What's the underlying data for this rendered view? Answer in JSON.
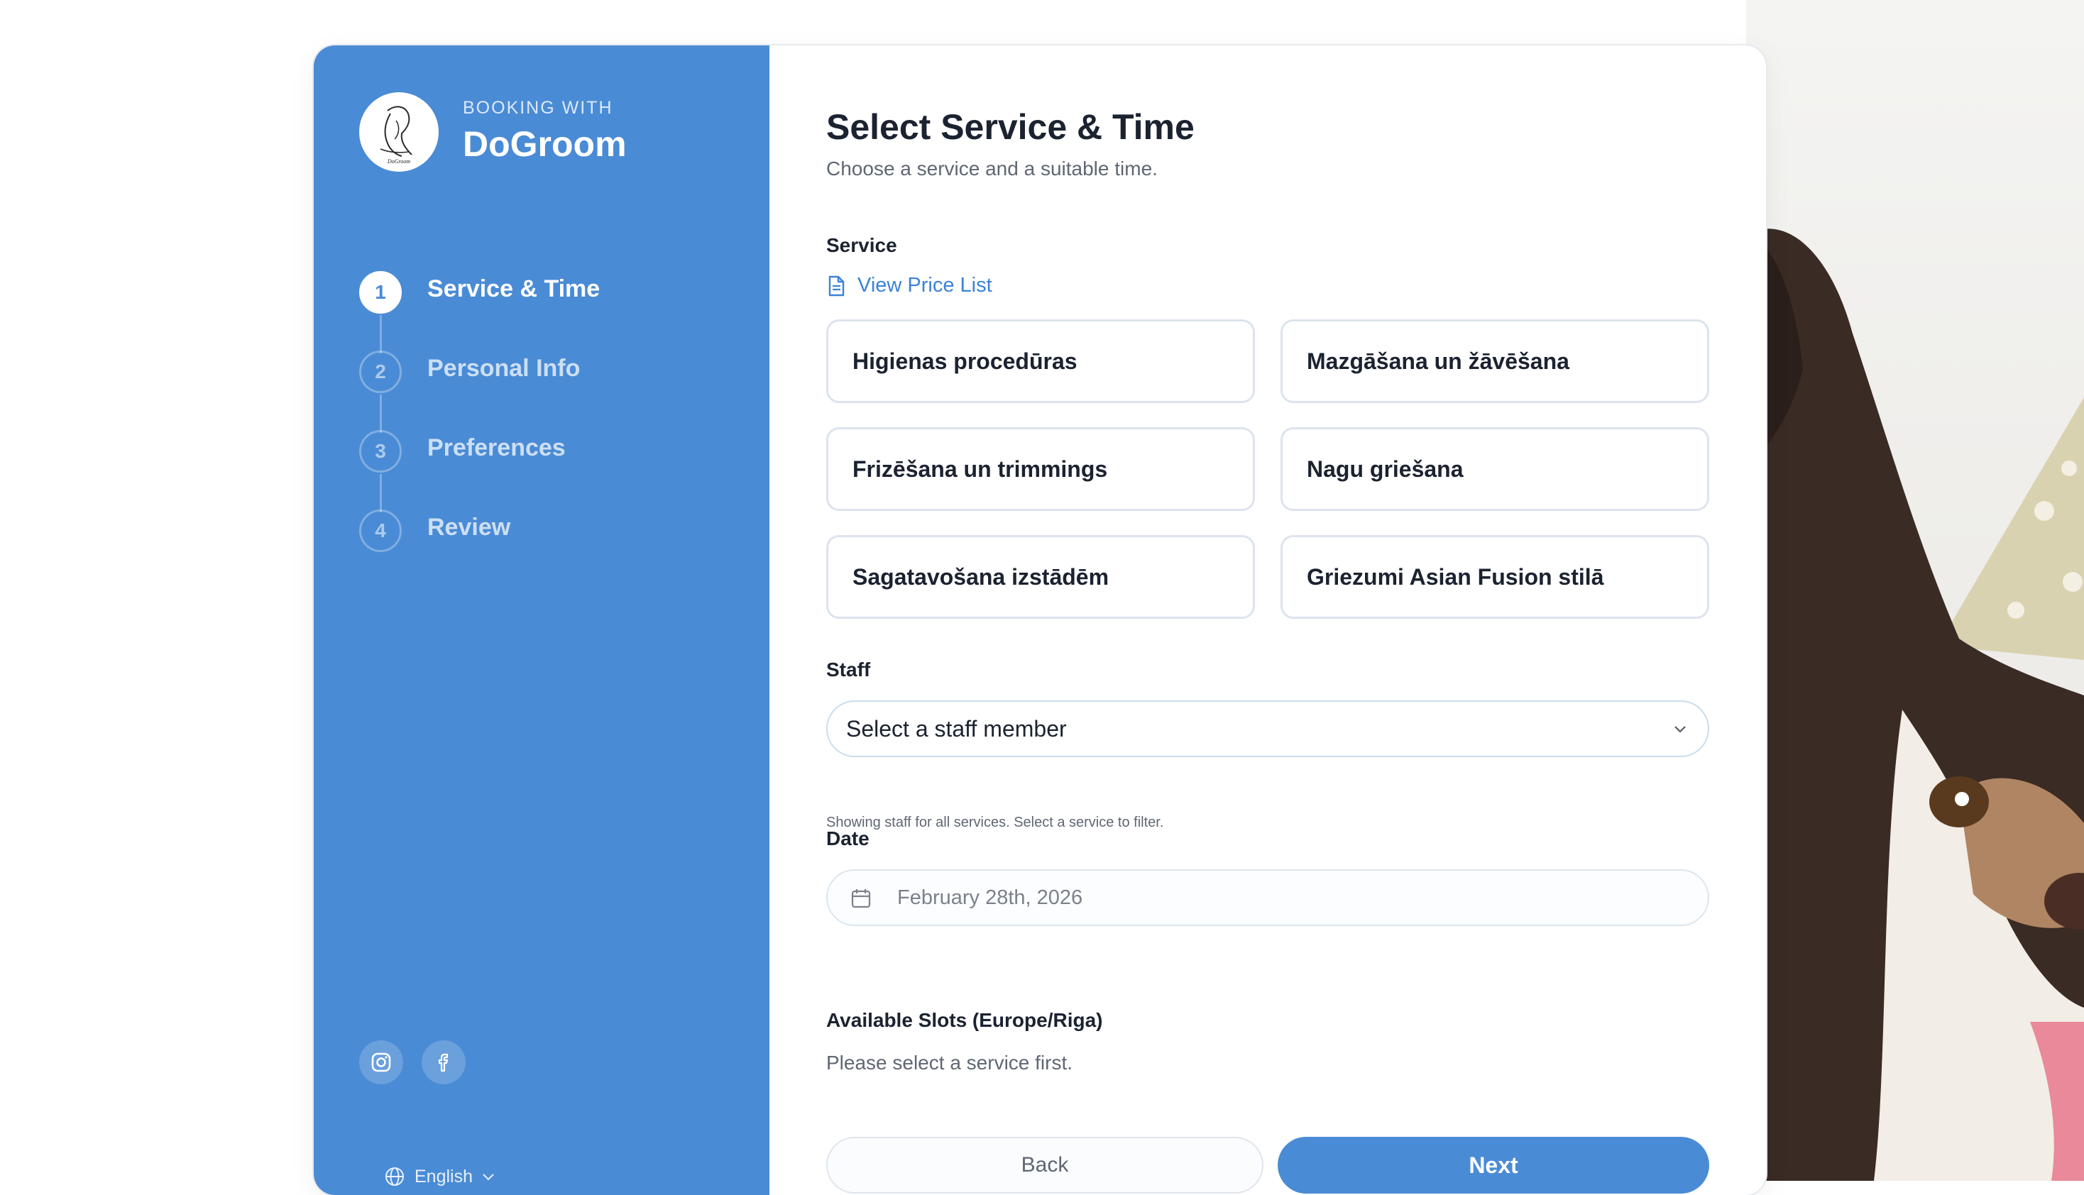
{
  "brand": {
    "eyebrow": "BOOKING WITH",
    "name": "DoGroom",
    "logo_text": "DoGroom"
  },
  "steps": [
    {
      "num": "1",
      "label": "Service & Time",
      "active": true
    },
    {
      "num": "2",
      "label": "Personal Info",
      "active": false
    },
    {
      "num": "3",
      "label": "Preferences",
      "active": false
    },
    {
      "num": "4",
      "label": "Review",
      "active": false
    }
  ],
  "social": [
    "instagram-icon",
    "facebook-icon"
  ],
  "language": {
    "selected": "English"
  },
  "main": {
    "title": "Select Service & Time",
    "subtitle": "Choose a service and a suitable time.",
    "service_label": "Service",
    "price_list_link": "View Price List",
    "services": [
      "Higienas procedūras",
      "Mazgāšana un žāvēšana",
      "Frizēšana un trimmings",
      "Nagu griešana",
      "Sagatavošana izstādēm",
      "Griezumi Asian Fusion stilā"
    ],
    "staff_label": "Staff",
    "staff_placeholder": "Select a staff member",
    "staff_hint": "Showing staff for all services. Select a service to filter.",
    "date_label": "Date",
    "date_value": "February 28th, 2026",
    "slots_label": "Available Slots (Europe/Riga)",
    "slots_message": "Please select a service first.",
    "back_button": "Back",
    "next_button": "Next"
  },
  "colors": {
    "accent": "#4a8bd5",
    "link": "#3b82d6",
    "text": "#1b2230",
    "muted": "#5f6773"
  }
}
